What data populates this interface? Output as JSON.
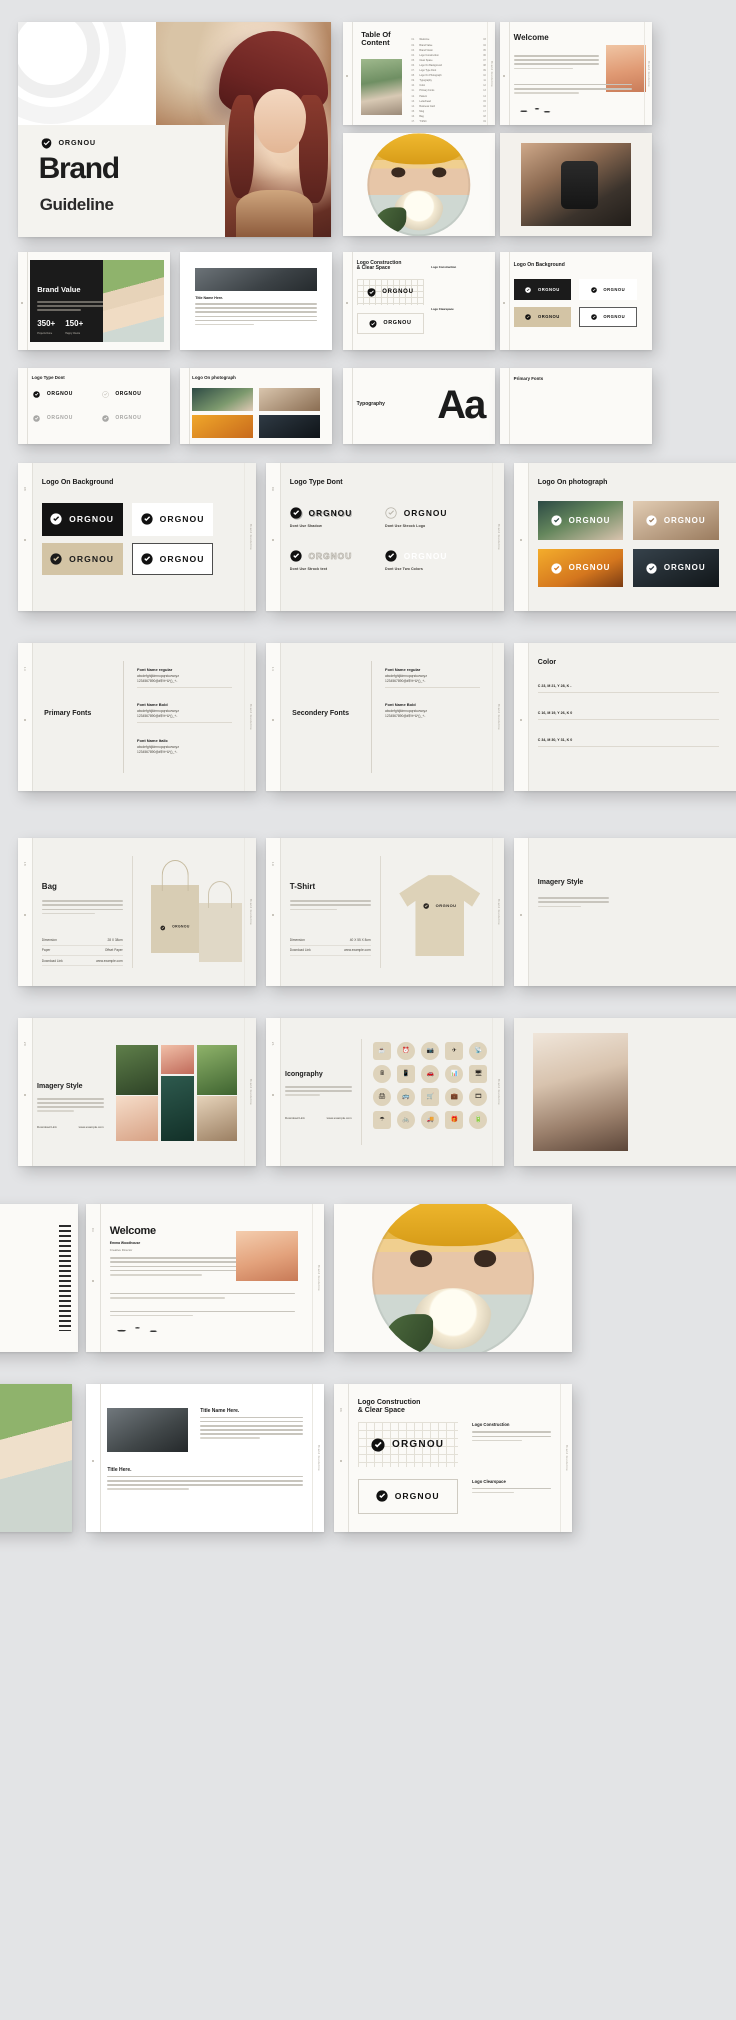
{
  "brand": {
    "name": "ORGNOU",
    "cover_title": "Brand",
    "cover_subtitle": "Guideline"
  },
  "colors": {
    "page_bg": "#e3e4e6",
    "slide_bg": "#f2f1ed",
    "ink": "#1b1b1b",
    "tan": "#d3c4a5",
    "accent_yellow": "#e8b84b"
  },
  "slides": {
    "toc": {
      "title": "Table Of\nContent",
      "items": [
        {
          "no": "01.",
          "label": "Welcome",
          "page": "03"
        },
        {
          "no": "02.",
          "label": "Brand Value",
          "page": "04"
        },
        {
          "no": "03.",
          "label": "Brand Vision",
          "page": "05"
        },
        {
          "no": "04.",
          "label": "Logo Construction",
          "page": "06"
        },
        {
          "no": "05.",
          "label": "Clear Space",
          "page": "07"
        },
        {
          "no": "06.",
          "label": "Logo On Background",
          "page": "08"
        },
        {
          "no": "07.",
          "label": "Logo Type Dont",
          "page": "09"
        },
        {
          "no": "08.",
          "label": "Logo On Photograph",
          "page": "10"
        },
        {
          "no": "09.",
          "label": "Typography",
          "page": "11"
        },
        {
          "no": "10.",
          "label": "Color",
          "page": "12"
        },
        {
          "no": "11.",
          "label": "Primary Fonts",
          "page": "13"
        },
        {
          "no": "12.",
          "label": "Pattern",
          "page": "14"
        },
        {
          "no": "13.",
          "label": "Letterhead",
          "page": "15"
        },
        {
          "no": "14.",
          "label": "Business Card",
          "page": "16"
        },
        {
          "no": "15.",
          "label": "Mug",
          "page": "17"
        },
        {
          "no": "16.",
          "label": "Bag",
          "page": "18"
        },
        {
          "no": "17.",
          "label": "T-Shirt",
          "page": "19"
        },
        {
          "no": "18.",
          "label": "Imagery Style",
          "page": "20"
        },
        {
          "no": "19.",
          "label": "Icongraphy",
          "page": "21"
        },
        {
          "no": "20.",
          "label": "Thank You",
          "page": "22"
        }
      ]
    },
    "welcome": {
      "title": "Welcome",
      "person_name": "Emma Woodhouse",
      "person_role": "Creative Director",
      "body": "Welcome to the all new brand guideline for ORGNOU. This document defines the visual language of our brand and how every element works together across print and digital touchpoints."
    },
    "brand_value": {
      "title": "Brand Value",
      "stats": [
        {
          "value": "350+",
          "label": "Projects Done"
        },
        {
          "value": "150+",
          "label": "Happy Clients"
        }
      ]
    },
    "title_here": {
      "title_1": "Title Name Here.",
      "title_2": "Title Here."
    },
    "logo_construction": {
      "title": "Logo Construction\n& Clear Space",
      "section_1": "Logo Construction",
      "section_2": "Logo Clearspace"
    },
    "logo_on_background": {
      "title": "Logo On Background",
      "swatches": [
        "#131313",
        "#ffffff",
        "#d3c4a5",
        "#ffffff"
      ]
    },
    "logo_type_dont": {
      "title": "Logo Type Dont",
      "rules": [
        "Dont Use Shadow",
        "Dont Use Steock Logo",
        "Dont Use Strock text",
        "Dont Use Two Colors"
      ]
    },
    "logo_on_photograph": {
      "title": "Logo On photograph"
    },
    "typography": {
      "title": "Typography",
      "sample": "Aa"
    },
    "primary_fonts": {
      "title": "Primary Fonts",
      "specs": [
        {
          "name": "Font Name regular",
          "lower": "abcdefghijklmnopqrstuvwxyz",
          "upper": "1234567890@#$%^&*()_+-"
        },
        {
          "name": "Font Name Bold",
          "lower": "abcdefghijklmnopqrstuvwxyz",
          "upper": "1234567890@#$%^&*()_+-"
        },
        {
          "name": "Font Name Italic",
          "lower": "abcdefghijklmnopqrstuvwxyz",
          "upper": "1234567890@#$%^&*()_+-"
        }
      ]
    },
    "secondary_fonts": {
      "title": "Secondery Fonts",
      "specs": [
        {
          "name": "Font Name regular",
          "lower": "abcdefghijklmnopqrstuvwxyz",
          "upper": "1234567890@#$%^&*()_+-"
        },
        {
          "name": "Font Name Bold",
          "lower": "abcdefghijklmnopqrstuvwxyz",
          "upper": "1234567890@#$%^&*()_+-"
        }
      ]
    },
    "color": {
      "title": "Color",
      "swatches": [
        {
          "cmyk": "C 23, M 21, Y 28, K -"
        },
        {
          "cmyk": "C 16, M 19, Y 26, K 0"
        },
        {
          "cmyk": "C 34, M 30, Y 31, K 0"
        }
      ]
    },
    "bag": {
      "title": "Bag",
      "body": "Lorem ipsum dolor sit amet consectetur adipiscing elit sed do eiusmod tempor incididunt ut labore et dolore magna aliqua enim ad minim veniam quis nostrud.",
      "meta": [
        {
          "k": "Dimension",
          "v": "28 X 38cm"
        },
        {
          "k": "Paper",
          "v": "Offset Paper"
        },
        {
          "k": "Download Link",
          "v": "www.example.com"
        }
      ]
    },
    "tshirt": {
      "title": "T-Shirt",
      "body": "Lorem ipsum dolor sit amet consectetur adipiscing elit sed do eiusmod tempor incididunt ut labore.",
      "meta": [
        {
          "k": "Dimension",
          "v": "40 X 55 X 8cm"
        },
        {
          "k": "Download Link",
          "v": "www.example.com"
        }
      ]
    },
    "imagery_style": {
      "title": "Imagery Style",
      "body": "Lorem ipsum dolor sit amet consectetur adipiscing elit sed do eiusmod tempor incididunt.",
      "meta": [
        {
          "k": "Download Link",
          "v": "www.example.com"
        }
      ]
    },
    "icongraphy": {
      "title": "Icongraphy",
      "body": "Lorem ipsum dolor sit amet consectetur adipiscing elit sed do eiusmod tempor.",
      "meta": [
        {
          "k": "Download Link",
          "v": "www.example.com"
        }
      ],
      "icons": [
        "coffee-icon",
        "alarm-clock-icon",
        "camera-icon",
        "airplane-icon",
        "antenna-icon",
        "calculator-icon",
        "mobile-icon",
        "car-icon",
        "chart-icon",
        "monitor-icon",
        "printer-icon",
        "bus-icon",
        "shopping-cart-icon",
        "suitcase-icon",
        "film-icon",
        "umbrella-icon",
        "bicycle-icon",
        "truck-icon",
        "gift-icon",
        "battery-icon"
      ]
    }
  },
  "footer_label": "Brand Guideline"
}
